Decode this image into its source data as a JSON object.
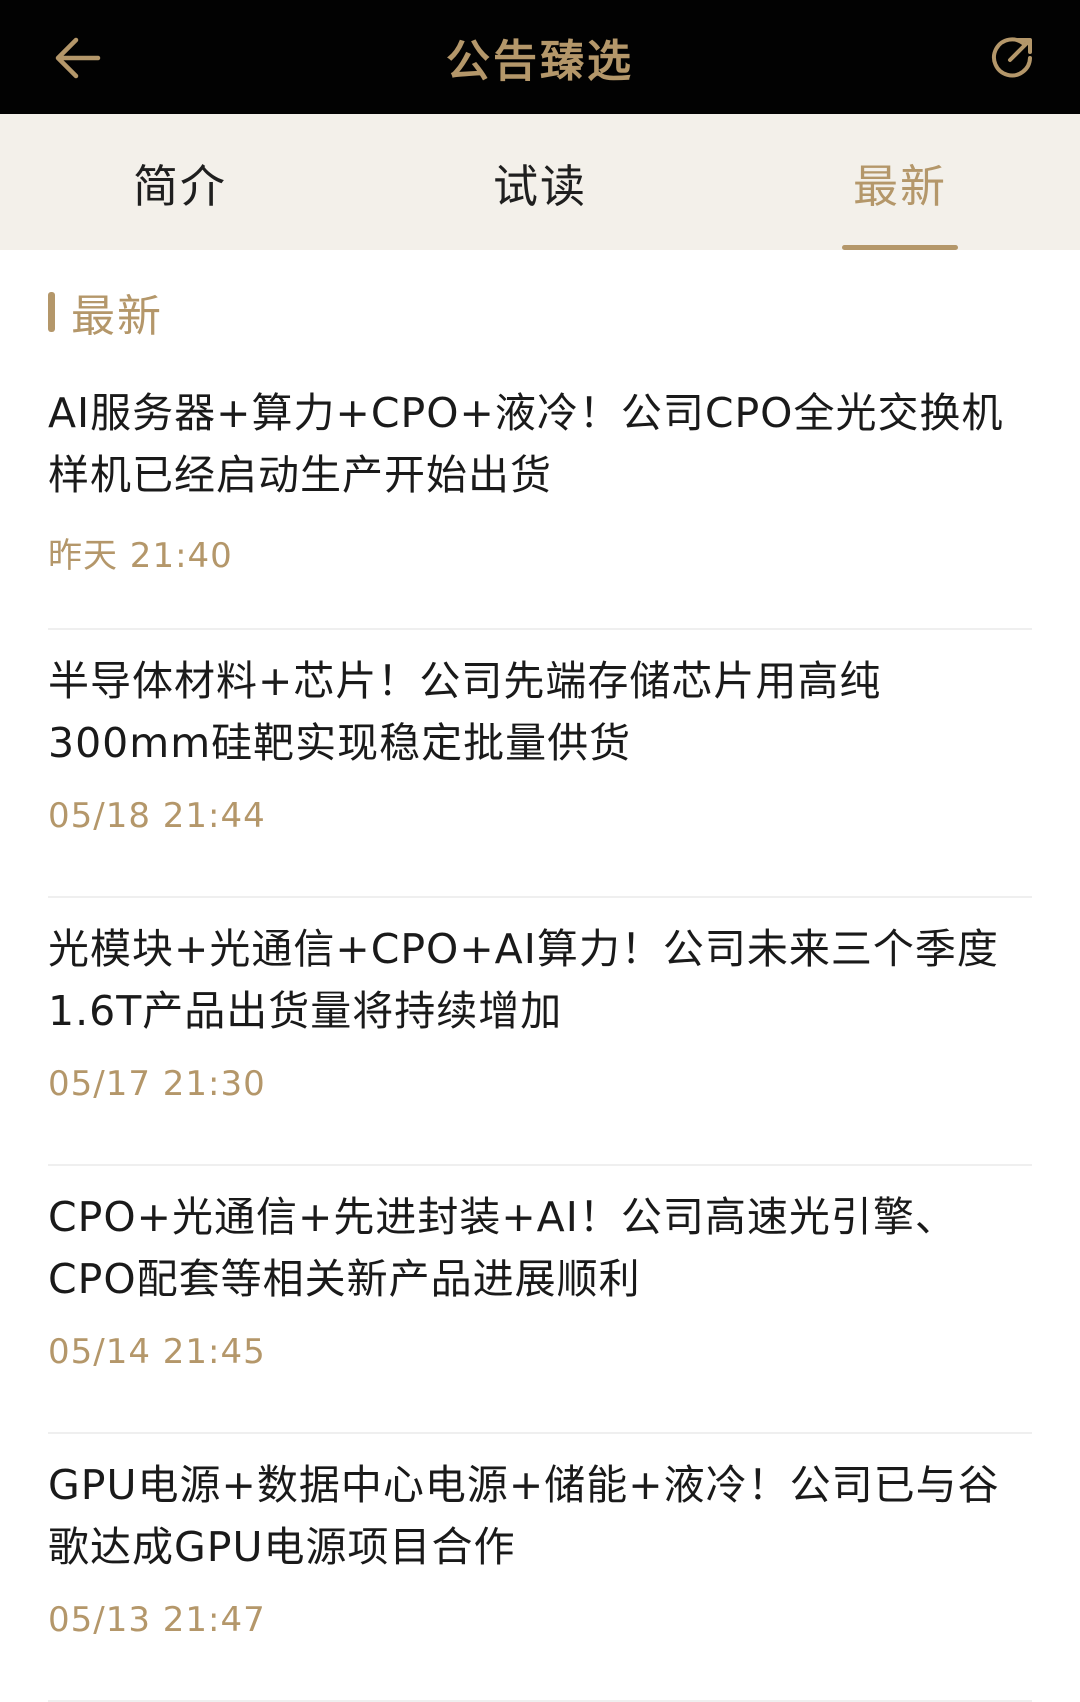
{
  "colors": {
    "accent": "#b4976a",
    "header_bg": "#020202",
    "tabs_bg": "#f3f0ea"
  },
  "header": {
    "title": "公告臻选",
    "back_icon": "arrow-left-icon",
    "share_icon": "share-icon"
  },
  "tabs": [
    {
      "label": "简介",
      "active": false
    },
    {
      "label": "试读",
      "active": false
    },
    {
      "label": "最新",
      "active": true
    }
  ],
  "section": {
    "title": "最新"
  },
  "news": [
    {
      "title": "AI服务器+算力+CPO+液冷！公司CPO全光交换机样机已经启动生产开始出货",
      "time": "昨天 21:40"
    },
    {
      "title": "半导体材料+芯片！公司先端存储芯片用高纯300mm硅靶实现稳定批量供货",
      "time": "05/18 21:44"
    },
    {
      "title": "光模块+光通信+CPO+AI算力！公司未来三个季度1.6T产品出货量将持续增加",
      "time": "05/17 21:30"
    },
    {
      "title": "CPO+光通信+先进封装+AI！公司高速光引擎、CPO配套等相关新产品进展顺利",
      "time": "05/14 21:45"
    },
    {
      "title": "GPU电源+数据中心电源+储能+液冷！公司已与谷歌达成GPU电源项目合作",
      "time": "05/13 21:47"
    }
  ]
}
